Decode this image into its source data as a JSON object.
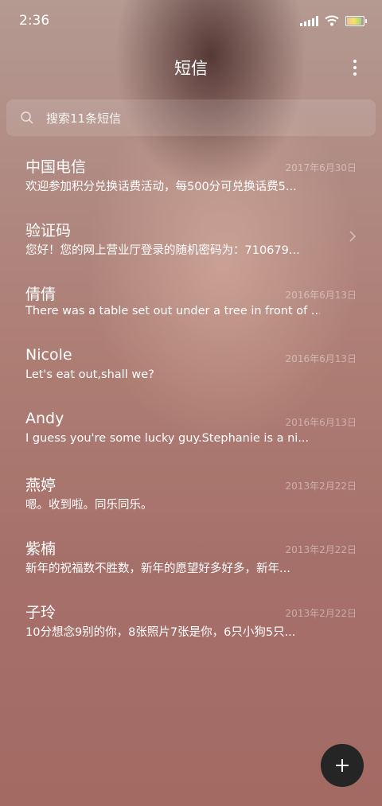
{
  "status_bar": {
    "time": "2:36"
  },
  "header": {
    "title": "短信"
  },
  "search": {
    "placeholder": "搜索11条短信"
  },
  "messages": [
    {
      "name": "中国电信",
      "date": "2017年6月30日",
      "preview": "欢迎参加积分兑换话费活动，每500分可兑换话费5...",
      "chevron": false
    },
    {
      "name": "验证码",
      "date": "",
      "preview": "您好！您的网上营业厅登录的随机密码为：710679...",
      "chevron": true
    },
    {
      "name": "倩倩",
      "date": "2016年6月13日",
      "preview": "There was a table set out under a tree in front of ...",
      "chevron": false
    },
    {
      "name": "Nicole",
      "date": "2016年6月13日",
      "preview": "Let's eat out,shall we?",
      "chevron": false
    },
    {
      "name": "Andy",
      "date": "2016年6月13日",
      "preview": "I guess you're some lucky guy.Stephanie is a ni...",
      "chevron": false
    },
    {
      "name": "燕婷",
      "date": "2013年2月22日",
      "preview": "嗯。收到啦。同乐同乐。",
      "chevron": false
    },
    {
      "name": "紫楠",
      "date": "2013年2月22日",
      "preview": "新年的祝福数不胜数，新年的愿望好多好多，新年...",
      "chevron": false
    },
    {
      "name": "子玲",
      "date": "2013年2月22日",
      "preview": "10分想念9别的你，8张照片7张是你，6只小狗5只...",
      "chevron": false
    }
  ],
  "icons": {
    "search": "search-icon",
    "more": "more-vertical-icon",
    "chevron": "chevron-right-icon",
    "compose": "plus-icon",
    "signal": "signal-icon",
    "wifi": "wifi-icon",
    "battery": "battery-icon"
  },
  "battery_level": 0.9
}
